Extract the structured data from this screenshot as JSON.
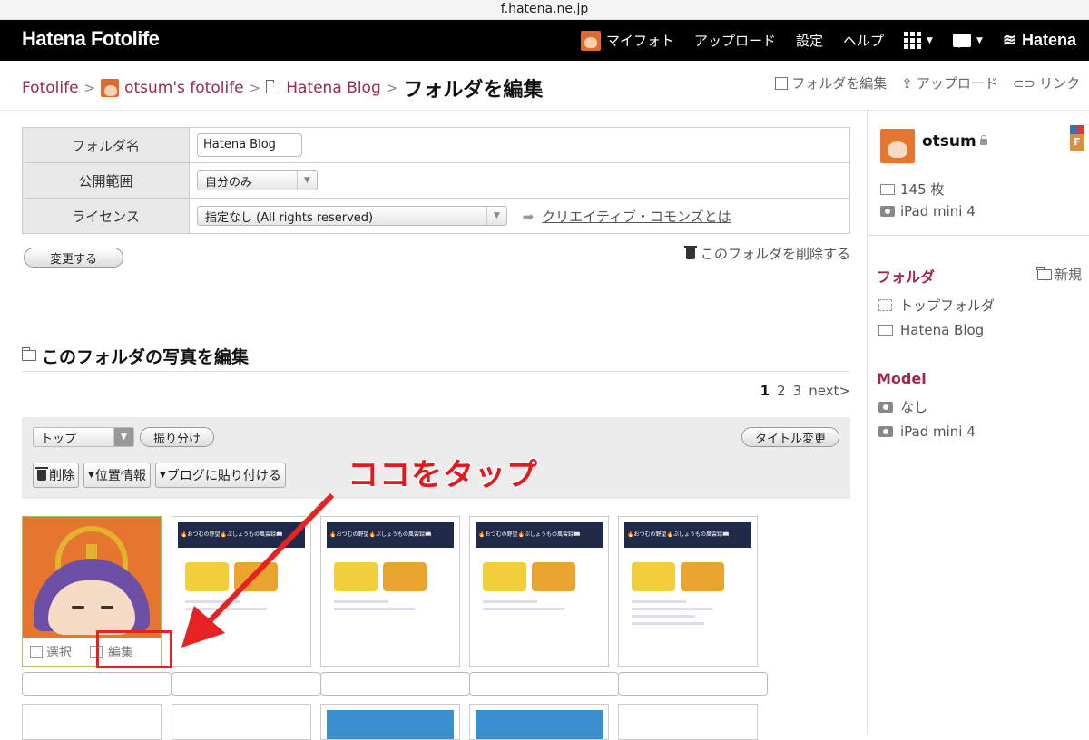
{
  "browser": {
    "url": "f.hatena.ne.jp"
  },
  "topnav": {
    "brand": "Hatena Fotolife",
    "my_photo": "マイフォト",
    "upload": "アップロード",
    "settings": "設定",
    "help": "ヘルプ",
    "hatena": "Hatena"
  },
  "breadcrumb": {
    "root": "Fotolife",
    "sep": ">",
    "user": "otsum's fotolife",
    "folder": "Hatena Blog",
    "current": "フォルダを編集"
  },
  "crumb_actions": {
    "edit_folder": "フォルダを編集",
    "upload": "アップロード",
    "link": "リンク"
  },
  "form": {
    "folder_name_label": "フォルダ名",
    "folder_name_value": "Hatena Blog",
    "visibility_label": "公開範囲",
    "visibility_value": "自分のみ",
    "license_label": "ライセンス",
    "license_value": "指定なし (All rights reserved)",
    "cc_link": "クリエイティブ・コモンズとは",
    "submit": "変更する",
    "delete_folder": "このフォルダを削除する"
  },
  "photos_section": {
    "title": "このフォルダの写真を編集",
    "pager": {
      "pages": [
        "1",
        "2",
        "3"
      ],
      "next": "next>",
      "current": "1"
    },
    "toolbar": {
      "move_select": "トップ",
      "sort": "振り分け",
      "title_change": "タイトル変更",
      "delete": "削除",
      "location": "位置情報",
      "blog_paste": "ブログに貼り付ける"
    },
    "thumb_actions": {
      "select": "選択",
      "edit": "編集"
    },
    "screenshot_banner": "🔥おつむの野望🔥ぶしょうもの風雲録📖"
  },
  "annotation": {
    "text": "ココをタップ",
    "color": "#e4191e"
  },
  "sidebar": {
    "username": "otsum",
    "medal": "F",
    "photo_count": "145 枚",
    "device": "iPad mini 4",
    "folders_heading": "フォルダ",
    "new_folder": "新規",
    "folders": [
      "トップフォルダ",
      "Hatena Blog"
    ],
    "model_heading": "Model",
    "models": [
      "なし",
      "iPad mini 4"
    ]
  },
  "colors": {
    "accent": "#a0284b",
    "topbar": "#000000",
    "annotation_red": "#e62222"
  }
}
